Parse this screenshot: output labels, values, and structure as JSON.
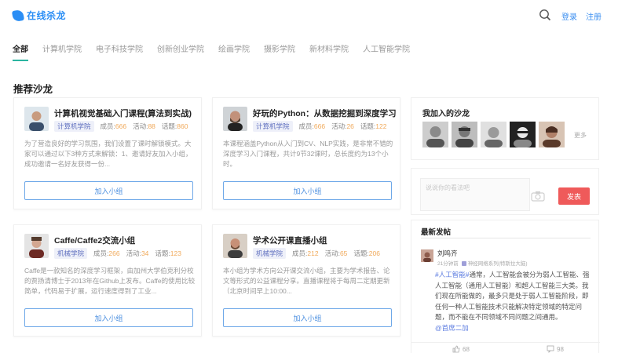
{
  "header": {
    "logo_text": "在线杀龙",
    "login": "登录",
    "register": "注册"
  },
  "tabs": [
    "全部",
    "计算机学院",
    "电子科技学院",
    "创新创业学院",
    "绘画学院",
    "摄影学院",
    "新材料学院",
    "人工智能学院"
  ],
  "section_title": "推荐沙龙",
  "labels": {
    "members": "成员:",
    "activities": "活动:",
    "topics": "话题:",
    "join": "加入小组"
  },
  "salons": [
    {
      "title": "计算机视觉基础入门课程(算法到实战)",
      "tag": "计算机学院",
      "members": "666",
      "activities": "88",
      "topics": "860",
      "desc": "为了营造良好的学习氛围，我们设置了课时解锁模式。大家可以通过以下3种方式来解锁：1、邀请好友加入小组，成功邀请一名好友获得一份..."
    },
    {
      "title": "好玩的Python：从数据挖掘到深度学习",
      "tag": "计算机学院",
      "members": "666",
      "activities": "26",
      "topics": "122",
      "desc": "本课程涵盖Python从入门到CV、NLP实践，是非常不错的深度学习入门课程，共计9节32课时，总长度约为13个小时。"
    },
    {
      "title": "Caffe/Caffe2交流小组",
      "tag": "机械学院",
      "members": "266",
      "activities": "34",
      "topics": "123",
      "desc": "Caffe是一款知名的深度学习框架，由加州大学伯克利分校的贾扬清博士于2013年在Github上发布。Caffe的使用比较简单，代码易于扩展，运行速度得到了工业..."
    },
    {
      "title": "学术公开课直播小组",
      "tag": "机械学院",
      "members": "212",
      "activities": "65",
      "topics": "206",
      "desc": "本小组为学术方向公开课交流小组，主要为学术报告、论文等形式的公益课程分享。直播课程将于每周二定期更新（北京时间早上10:00..."
    }
  ],
  "right": {
    "joined_title": "我加入的沙龙",
    "more": "更多",
    "post_placeholder": "说说你的看法吧",
    "publish": "发表",
    "latest_title": "最新发帖",
    "post": {
      "author": "刘鸣齐",
      "time": "21分钟前",
      "group": "神经网络系列(特斯拉大脑)",
      "hashtag": "#人工智能#",
      "body": "通常，人工智能会被分为弱人工智能、强人工智能（通用人工智能）和超人工智能三大类。我们现在所能做的，最多只是处于弱人工智能阶段，即任何一种人工智能技术只能解决特定领域的特定问题，而不能在不同领域不同问题之间通用。",
      "mention": "@首席二加",
      "likes": "68",
      "comments": "98"
    }
  },
  "colors": {
    "accent": "#2bb5a0",
    "brand": "#2b8ef5",
    "publish": "#ef5a5a",
    "number": "#f0a95a"
  }
}
